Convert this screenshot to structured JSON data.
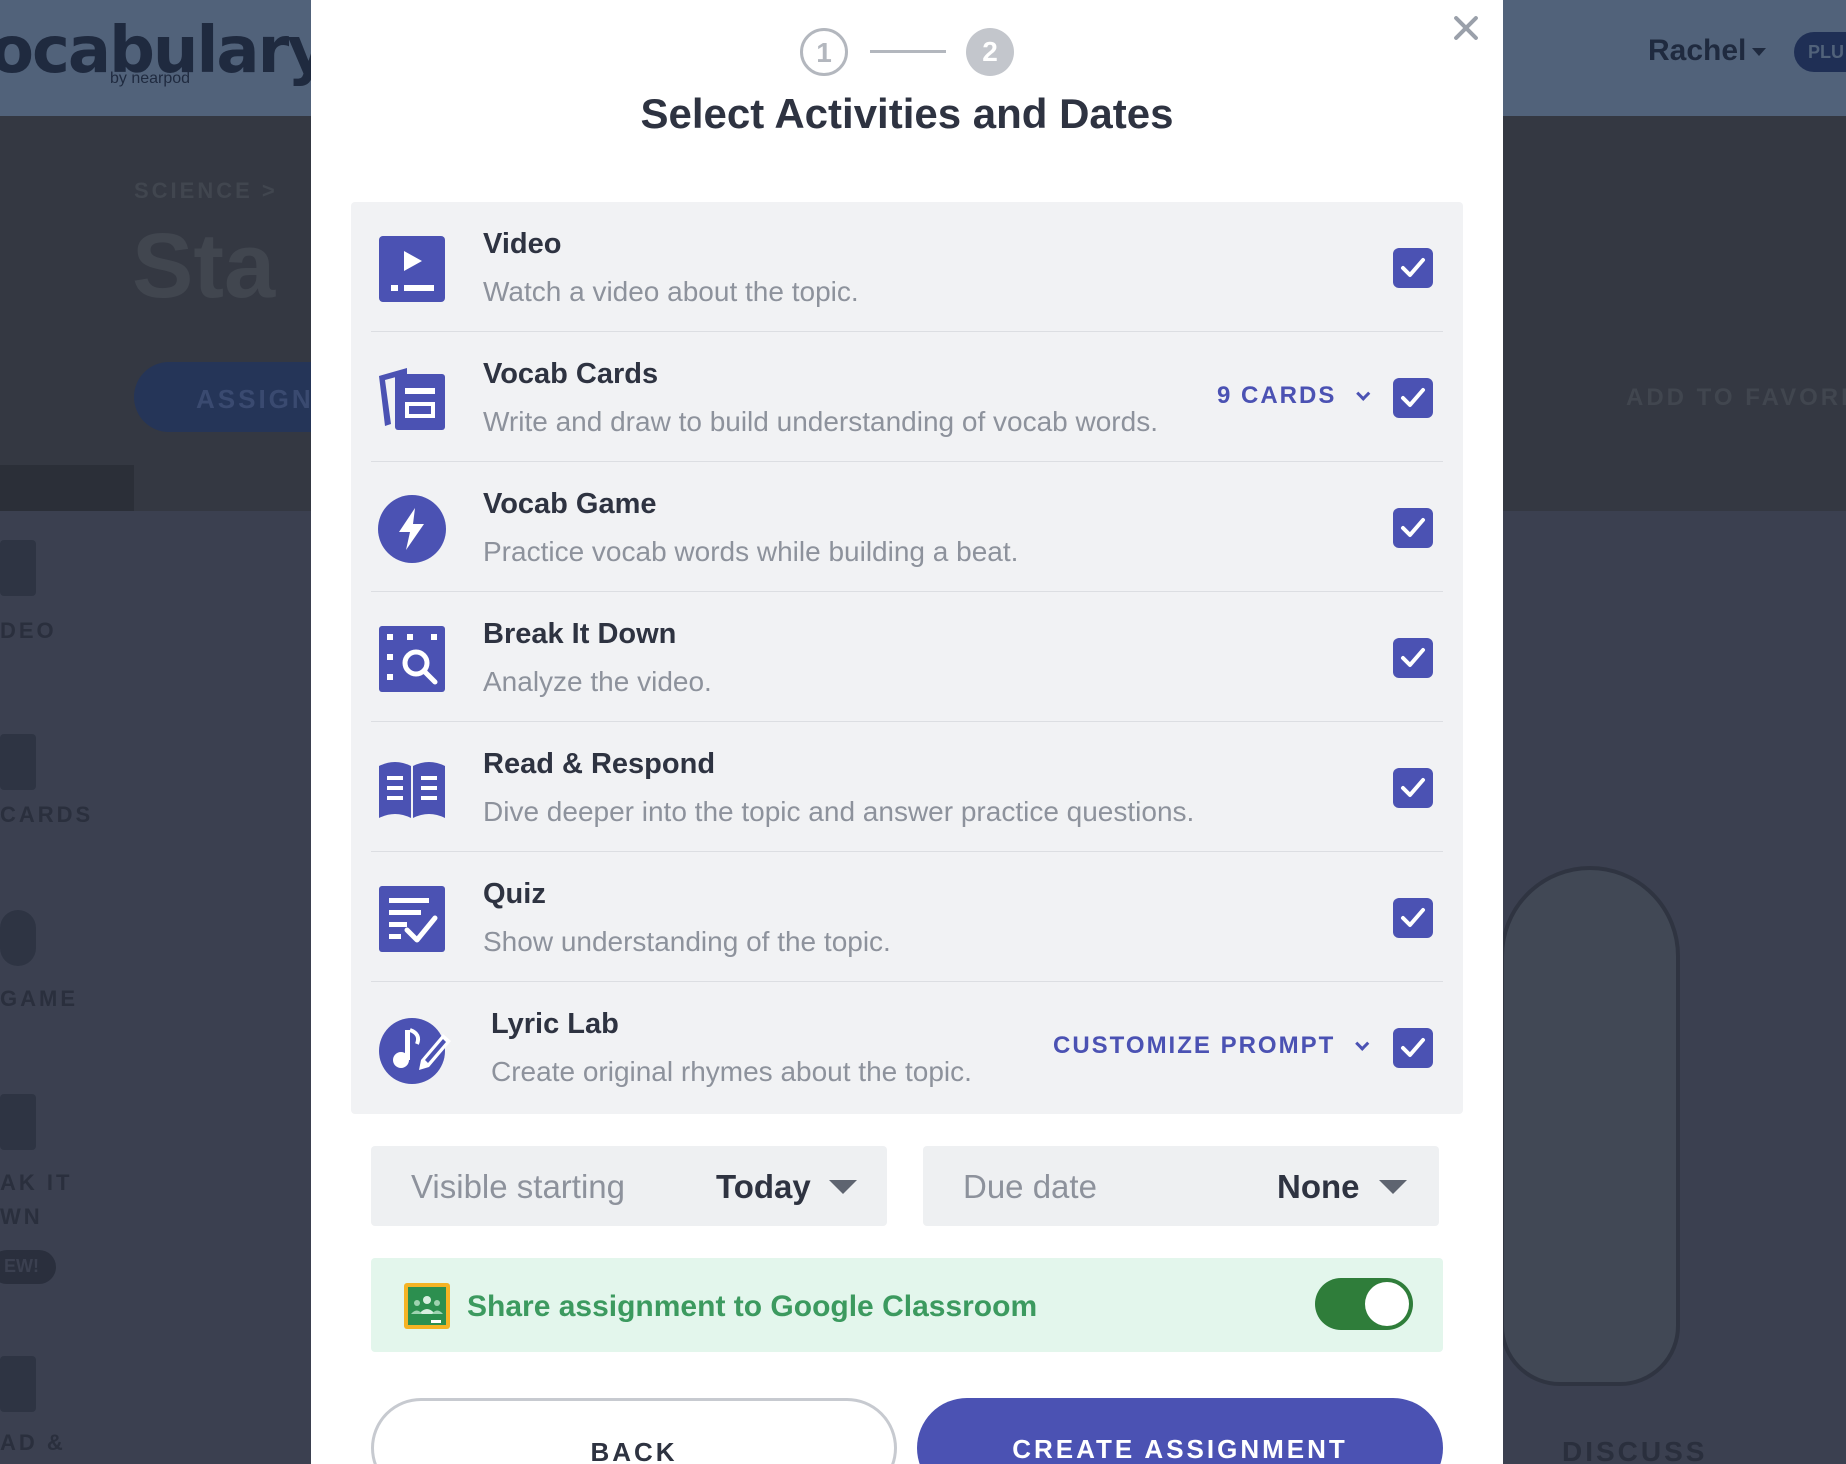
{
  "background": {
    "logo": "ocabulary",
    "logo_sub": "by nearpod",
    "user_name": "Rachel",
    "plan_badge": "PLU",
    "breadcrumb": "SCIENCE > ",
    "page_title": "Sta",
    "assign_label": "ASSIGN",
    "favorite_label": "ADD TO FAVORI",
    "side_items": [
      "DEO",
      "CARDS",
      "GAME",
      "AK IT",
      "WN",
      "AD &"
    ],
    "new_badge": "EW!",
    "discuss_label": "DISCUSS"
  },
  "modal": {
    "close_icon": "close-icon",
    "steps": [
      "1",
      "2"
    ],
    "title": "Select Activities and Dates",
    "activities": [
      {
        "title": "Video",
        "description": "Watch a video about the topic.",
        "icon": "video-icon",
        "checked": true,
        "extra": ""
      },
      {
        "title": "Vocab Cards",
        "description": "Write and draw to build understanding of vocab words.",
        "icon": "vocab-cards-icon",
        "checked": true,
        "extra": "9 CARDS"
      },
      {
        "title": "Vocab Game",
        "description": "Practice vocab words while building a beat.",
        "icon": "lightning-icon",
        "checked": true,
        "extra": ""
      },
      {
        "title": "Break It Down",
        "description": "Analyze the video.",
        "icon": "magnifier-icon",
        "checked": true,
        "extra": ""
      },
      {
        "title": "Read & Respond",
        "description": "Dive deeper into the topic and answer practice questions.",
        "icon": "book-icon",
        "checked": true,
        "extra": ""
      },
      {
        "title": "Quiz",
        "description": "Show understanding of the topic.",
        "icon": "quiz-icon",
        "checked": true,
        "extra": ""
      },
      {
        "title": "Lyric Lab",
        "description": "Create original rhymes about the topic.",
        "icon": "music-pencil-icon",
        "checked": true,
        "extra": "CUSTOMIZE PROMPT"
      }
    ],
    "visible_starting": {
      "label": "Visible starting",
      "value": "Today"
    },
    "due_date": {
      "label": "Due date",
      "value": "None"
    },
    "google_classroom": {
      "label": "Share assignment to Google Classroom",
      "enabled": true
    },
    "back_label": "BACK",
    "create_label": "CREATE ASSIGNMENT"
  },
  "colors": {
    "accent": "#4b52b3",
    "google_green": "#3c9a5f",
    "toggle_on": "#2f7d3a",
    "overlay": "#3b4050"
  }
}
